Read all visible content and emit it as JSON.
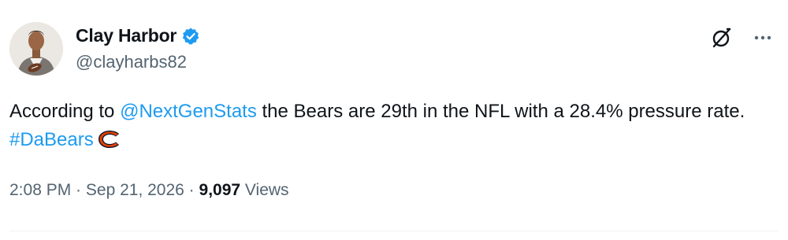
{
  "author": {
    "display_name": "Clay Harbor",
    "handle": "@clayharbs82",
    "verified": true
  },
  "tweet": {
    "text_before_mention": "According to ",
    "mention": "@NextGenStats",
    "text_after_mention": " the Bears are 29th in the NFL with a 28.4% pressure rate. ",
    "hashtag": "#DaBears",
    "emoji_icon": "chicago-bears-logo-icon"
  },
  "meta": {
    "time": "2:08 PM",
    "separator": " · ",
    "date": "Sep 21, 2026",
    "views_count": "9,097",
    "views_label": " Views"
  },
  "colors": {
    "link": "#1d9bf0",
    "secondary_text": "#536471",
    "primary_text": "#0f1419",
    "verified_badge": "#1d9bf0"
  }
}
